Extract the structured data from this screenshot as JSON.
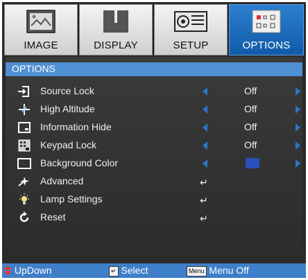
{
  "tabs": [
    {
      "label": "IMAGE",
      "icon": "image-icon",
      "active": false
    },
    {
      "label": "DISPLAY",
      "icon": "display-icon",
      "active": false
    },
    {
      "label": "SETUP",
      "icon": "setup-icon",
      "active": false
    },
    {
      "label": "OPTIONS",
      "icon": "options-icon",
      "active": true
    }
  ],
  "panel": {
    "title": "OPTIONS"
  },
  "items": [
    {
      "label": "Source Lock",
      "icon": "source-lock-icon",
      "value": "Off"
    },
    {
      "label": "High Altitude",
      "icon": "high-altitude-icon",
      "value": "Off"
    },
    {
      "label": "Information Hide",
      "icon": "information-hide-icon",
      "value": "Off"
    },
    {
      "label": "Keypad Lock",
      "icon": "keypad-lock-icon",
      "value": "Off"
    },
    {
      "label": "Background Color",
      "icon": "background-color-icon",
      "value_color": "#2a4fb8"
    },
    {
      "label": "Advanced",
      "icon": "advanced-icon",
      "submenu": "↵"
    },
    {
      "label": "Lamp Settings",
      "icon": "lamp-icon",
      "submenu": "↵"
    },
    {
      "label": "Reset",
      "icon": "reset-icon",
      "submenu": "↵"
    }
  ],
  "footer": {
    "updown": "UpDown",
    "select": "Select",
    "menu_key": "Menu",
    "menu_off": "Menu Off"
  },
  "colors": {
    "accent": "#4f8fd3",
    "arrow": "#2c76c9",
    "footer_bg": "#3f7fc9"
  }
}
